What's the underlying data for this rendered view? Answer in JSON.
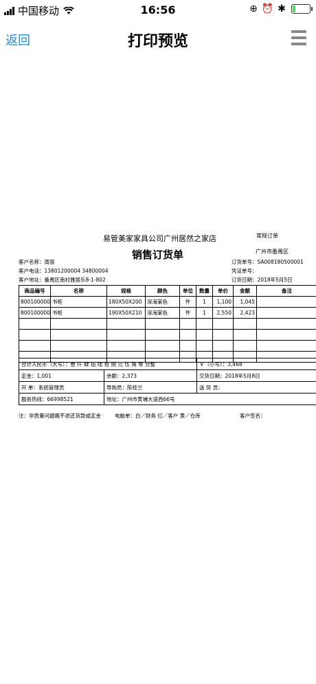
{
  "status_bar": {
    "carrier": "中国移动",
    "time": "16:56",
    "icons": [
      "signal-icon",
      "wifi-icon",
      "lock-rotation-icon",
      "alarm-icon",
      "bluetooth-icon",
      "battery-icon"
    ],
    "battery_color": "#4cd964"
  },
  "nav": {
    "back_label": "返回",
    "title": "打印预览",
    "menu_icon": "hamburger-menu-icon",
    "accent_color": "#1a8ee1"
  },
  "document": {
    "company": "易管美家家具公司广州居然之家店",
    "doc_type": "常规订单",
    "title": "销售订货单",
    "district": "广州市番禺区",
    "customer_name": "客户名称：周丽",
    "customer_phone": "客户电话：13801200004  34800004",
    "customer_address": "客户地址：番禺区南村雅居乐8-1-802",
    "order_no": "订货单号：SA008180500001",
    "voucher_no": "凭证单号：",
    "order_date": "订货日期：2018年5月5日",
    "columns": [
      "商品编号",
      "名称",
      "规格",
      "颜色",
      "单位",
      "数量",
      "单价",
      "金额",
      "备注"
    ],
    "rows": [
      [
        "8001000003",
        "书柜",
        "180X50X200",
        "深海棠色",
        "件",
        "1",
        "1,100",
        "1,045",
        ""
      ],
      [
        "8001000004",
        "书柜",
        "190X50X210",
        "深海棠色",
        "件",
        "1",
        "2,550",
        "2,423",
        ""
      ],
      [
        "",
        "",
        "",
        "",
        "",
        "",
        "",
        "",
        ""
      ],
      [
        "",
        "",
        "",
        "",
        "",
        "",
        "",
        "",
        ""
      ],
      [
        "",
        "",
        "",
        "",
        "",
        "",
        "",
        "",
        ""
      ],
      [
        "",
        "",
        "",
        "",
        "",
        "",
        "",
        "",
        ""
      ]
    ],
    "total_upper": "合计人民币（大写）：叁 仟 肆 佰 陆 拾 捌 元 伍 角 零 分整",
    "total_lower": "￥（小写）：3,468",
    "deposit": "定金：1,001",
    "balance": "余额：2,373",
    "delivery_date": "交货日期：2018年5月8日",
    "issuer": "开      单：系统管理员",
    "guide": "导购员：陈桂兰",
    "courier": "送   货   员：",
    "hotline": "服务热线：66998521",
    "address": "地址：广州市黄埔大道西66号",
    "note": "注：非质量问题概不退还货款或定金",
    "copies": "电脑单：白／财务  红／客户  黄／仓库",
    "signature": "客户签名："
  }
}
